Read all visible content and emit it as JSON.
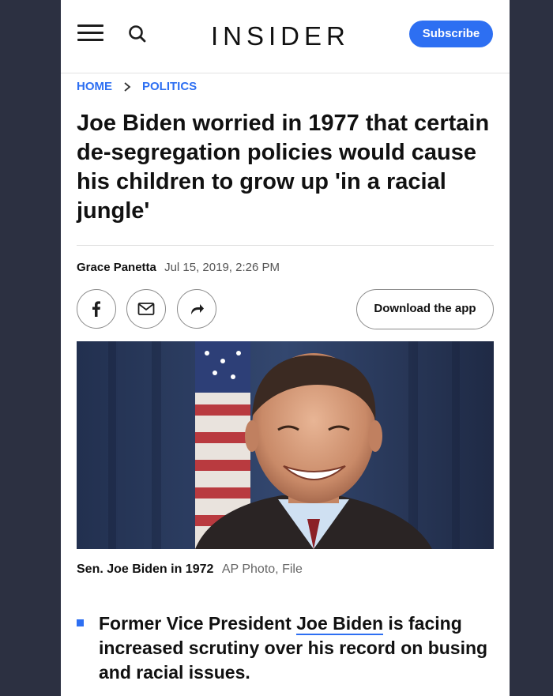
{
  "header": {
    "logo": "INSIDER",
    "subscribe_label": "Subscribe"
  },
  "breadcrumb": {
    "home": "HOME",
    "section": "POLITICS"
  },
  "article": {
    "headline": "Joe Biden worried in 1977 that certain de-segregation policies would cause his children to grow up 'in a racial jungle'",
    "author": "Grace Panetta",
    "date": "Jul 15, 2019, 2:26 PM",
    "download_label": "Download the app",
    "photo_caption": "Sen. Joe Biden in 1972",
    "photo_credit": "AP Photo, File",
    "bullet_before": "Former Vice President ",
    "bullet_link": "Joe Biden",
    "bullet_after": " is facing increased scrutiny over his record on busing and racial issues."
  },
  "icons": {
    "menu": "hamburger-icon",
    "search": "search-icon",
    "facebook": "facebook-icon",
    "email": "email-icon",
    "share": "share-icon"
  },
  "colors": {
    "accent": "#2d6ff2",
    "background": "#2c3041"
  }
}
